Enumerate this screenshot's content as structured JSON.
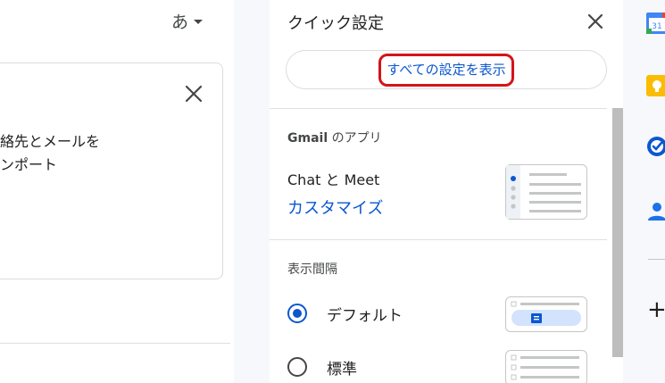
{
  "left": {
    "input_tool_label": "あ",
    "import_card": {
      "line1": "絡先とメールを",
      "line2": "ンポート"
    }
  },
  "quick_settings": {
    "title": "クイック設定",
    "all_settings_label": "すべての設定を表示",
    "apps_section": {
      "heading_bold": "Gmail",
      "heading_rest": " のアプリ",
      "item_label": "Chat と Meet",
      "customize_label": "カスタマイズ"
    },
    "density_section": {
      "heading": "表示間隔",
      "options": [
        {
          "label": "デフォルト",
          "checked": true
        },
        {
          "label": "標準",
          "checked": false
        }
      ]
    }
  },
  "side_rail": {
    "calendar_day": "31",
    "add_label": "+"
  },
  "colors": {
    "accent_blue": "#0b57d0",
    "highlight_red": "#d4141a",
    "keep_yellow": "#fbbc04"
  }
}
